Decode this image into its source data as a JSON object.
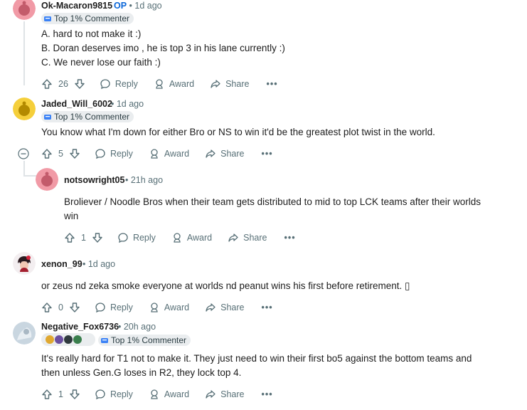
{
  "comments": [
    {
      "username": "Ok-Macaron9815",
      "op_label": "OP",
      "time": "• 1d ago",
      "flair": "Top 1% Commenter",
      "lines": [
        "A. hard to not make it :)",
        "B. Doran deserves imo , he is top 3 in his lane currently :)",
        "C. We never lose our faith :)"
      ],
      "votes": "26"
    },
    {
      "username": "Jaded_Will_6002",
      "time": "• 1d ago",
      "flair": "Top 1% Commenter",
      "lines": [
        "You know what I'm down for either Bro or NS to win it'd be the greatest plot twist in the world."
      ],
      "votes": "5"
    },
    {
      "username": "notsowright05",
      "time": "• 21h ago",
      "lines": [
        "Broliever / Noodle Bros when their team gets distributed to mid to top LCK teams after their worlds",
        "win"
      ],
      "votes": "1"
    },
    {
      "username": "xenon_99",
      "time": "• 1d ago",
      "lines": [
        "or zeus nd zeka smoke everyone at worlds nd peanut wins his first before retirement. ▯"
      ],
      "votes": "0"
    },
    {
      "username": "Negative_Fox6736",
      "time": "• 20h ago",
      "flair": "Top 1% Commenter",
      "lines": [
        "It's really hard for T1 not to make it. They just need to win their first bo5 against the bottom teams and",
        "then unless Gen.G loses in R2, they lock top 4."
      ],
      "votes": "1"
    }
  ],
  "actions": {
    "reply": "Reply",
    "award": "Award",
    "share": "Share",
    "more": "•••"
  },
  "colors": {
    "avatar_pink": "#f19aa6",
    "avatar_yellow": "#f5cf3b",
    "avatar_light": "#c9d6e0",
    "meta_gray": "#576f76",
    "op_blue": "#0a66d8"
  }
}
